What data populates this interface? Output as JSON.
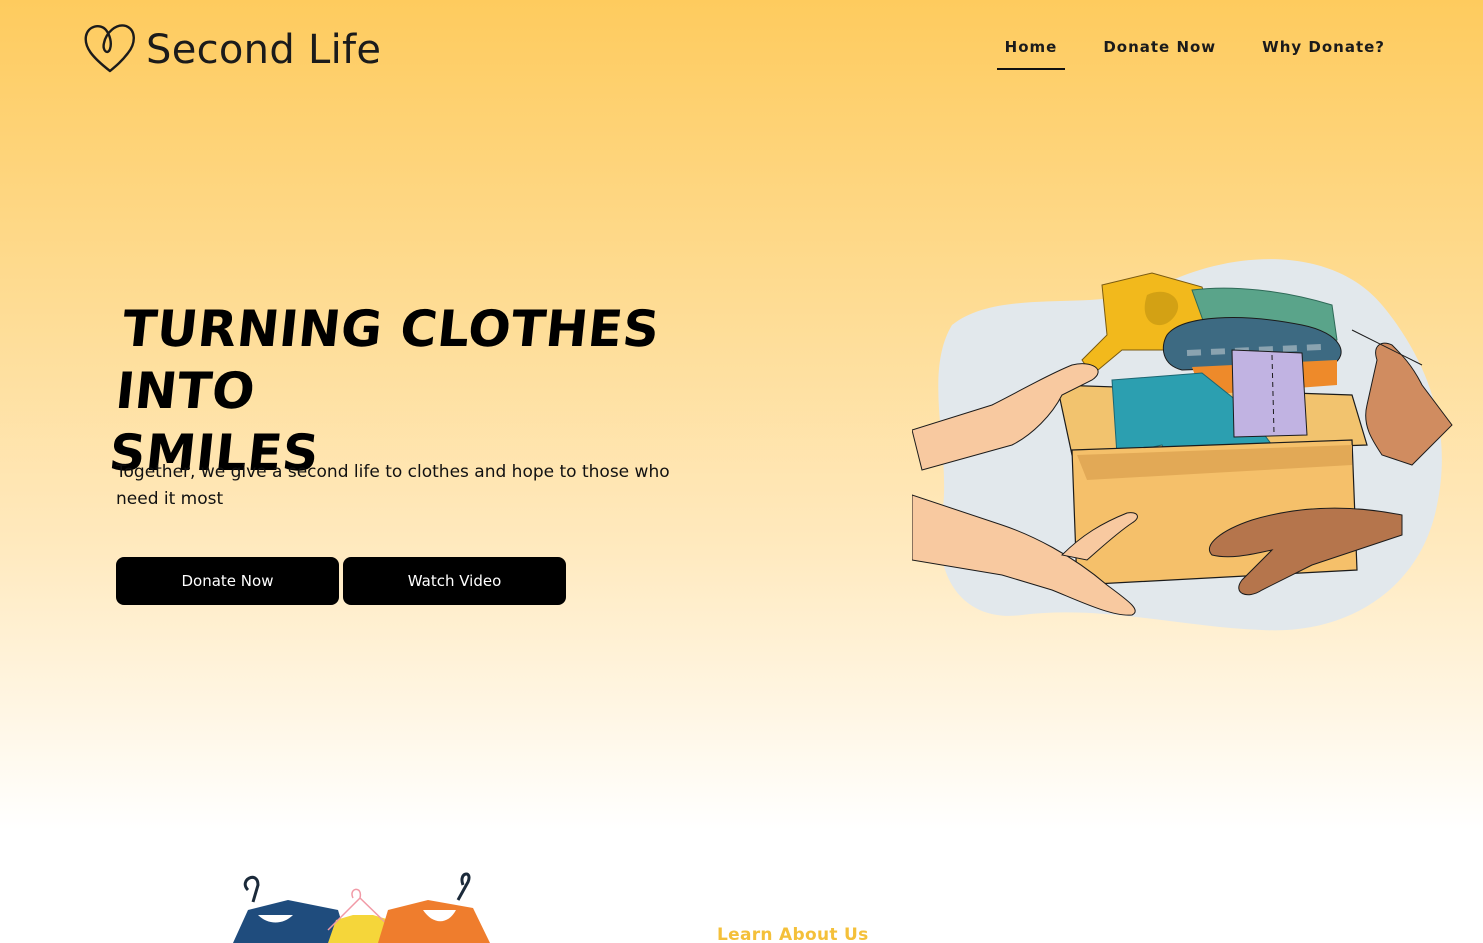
{
  "brand": {
    "name": "Second Life",
    "logo_icon": "heart-loop-icon"
  },
  "nav": {
    "items": [
      {
        "label": "Home",
        "active": true
      },
      {
        "label": "Donate Now",
        "active": false
      },
      {
        "label": "Why Donate?",
        "active": false
      }
    ]
  },
  "hero": {
    "headline_line1": "TURNING CLOTHES INTO",
    "headline_line2": "SMILES",
    "subtext": "Together, we give a second life to clothes and hope to those who need it most",
    "primary_button": "Donate Now",
    "secondary_button": "Watch Video",
    "illustration": "donation-box-handoff-illustration"
  },
  "about": {
    "link_label": "Learn About Us",
    "illustration": "clothes-on-hangers-illustration"
  },
  "colors": {
    "hero_top": "#fecb5e",
    "hero_bottom": "#ffffff",
    "accent": "#f4c03a",
    "button": "#000000"
  }
}
